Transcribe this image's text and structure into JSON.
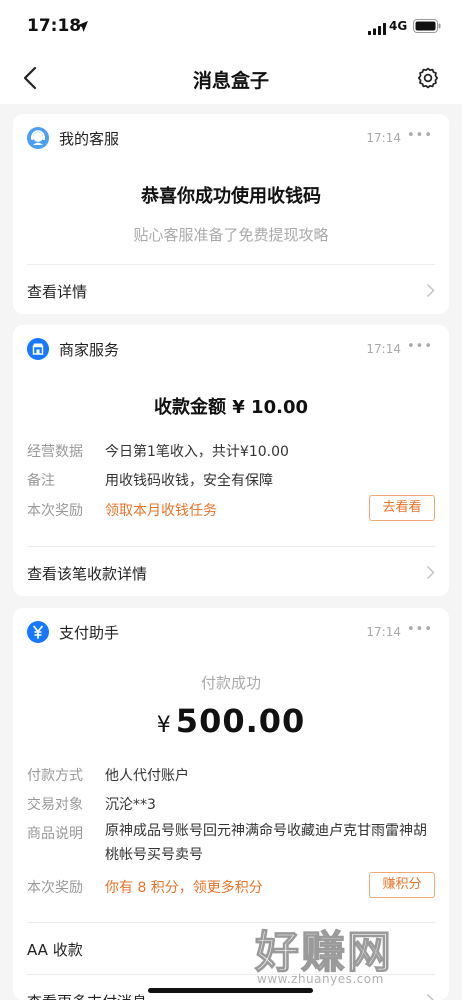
{
  "status": {
    "time": "17:18",
    "network": "4G"
  },
  "nav": {
    "title": "消息盒子",
    "back_icon": "chevron-left-icon",
    "settings_icon": "gear-icon"
  },
  "card_service": {
    "name": "我的客服",
    "time": "17:14",
    "more": "•••",
    "title": "恭喜你成功使用收钱码",
    "subtitle": "贴心客服准备了免费提现攻略",
    "link": "查看详情"
  },
  "card_merchant": {
    "name": "商家服务",
    "time": "17:14",
    "more": "•••",
    "amount_title": "收款金额 ¥ 10.00",
    "rows": [
      {
        "label": "经营数据",
        "value": "今日第1笔收入，共计¥10.00"
      },
      {
        "label": "备注",
        "value": "用收钱码收钱，安全有保障"
      },
      {
        "label": "本次奖励",
        "value": "领取本月收钱任务",
        "button": "去看看"
      }
    ],
    "link": "查看该笔收款详情"
  },
  "card_pay": {
    "name": "支付助手",
    "time": "17:14",
    "more": "•••",
    "status": "付款成功",
    "currency": "¥",
    "amount": "500.00",
    "rows": [
      {
        "label": "付款方式",
        "value": "他人代付账户"
      },
      {
        "label": "交易对象",
        "value": "沉沦**3"
      },
      {
        "label": "商品说明",
        "value": "原神成品号账号回元神满命号收藏迪卢克甘雨雷神胡桃帐号买号卖号"
      },
      {
        "label": "本次奖励",
        "value": "你有 8 积分，领更多积分",
        "button": "赚积分"
      }
    ],
    "link1": "AA 收款",
    "link2": "查看更多支付消息"
  },
  "watermark": {
    "text": "好赚网",
    "url": "www.zhuanyes.com"
  },
  "colors": {
    "accent_orange": "#e8742a",
    "icon_blue": "#1677ff",
    "service_blue": "#4a9ff5"
  }
}
